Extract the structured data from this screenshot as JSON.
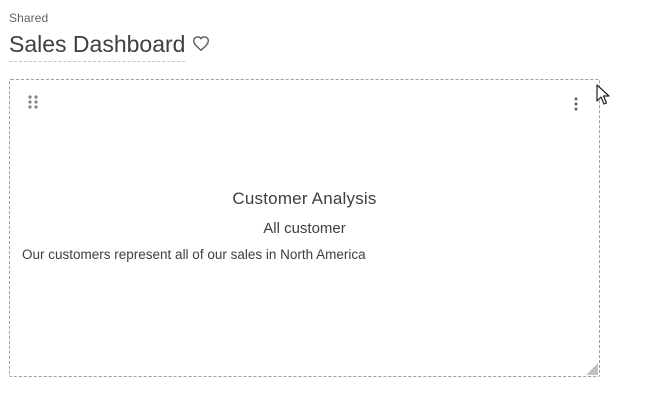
{
  "header": {
    "breadcrumb": "Shared",
    "title": "Sales Dashboard",
    "favorite_icon": "heart-outline-icon"
  },
  "tile": {
    "title": "Customer Analysis",
    "subtitle": "All customer",
    "body": "Our customers represent all of our sales in North America",
    "drag_icon": "drag-handle-icon",
    "menu_icon": "more-vert-icon",
    "resize_icon": "resize-handle-icon"
  },
  "colors": {
    "text": "#3c4043",
    "muted": "#5f6368",
    "border": "#9aa0a6"
  }
}
